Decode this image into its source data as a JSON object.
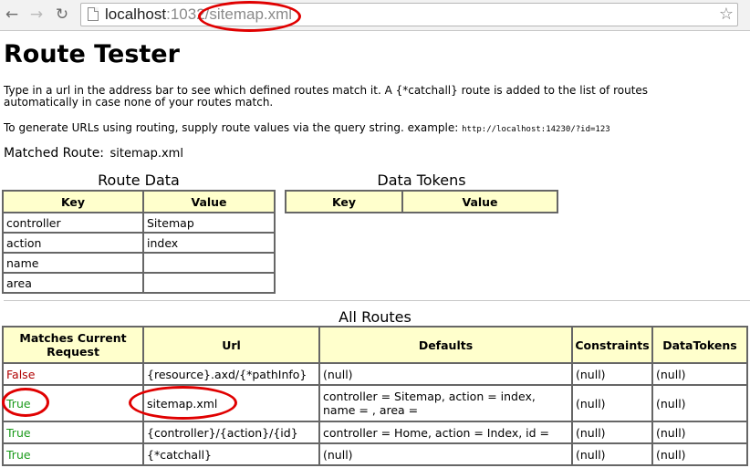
{
  "browser": {
    "back_label": "←",
    "forward_label": "→",
    "reload_label": "↻",
    "url_host": "localhost",
    "url_port": ":1032",
    "url_path": "/sitemap.xml",
    "star_label": "☆"
  },
  "page": {
    "title": "Route Tester",
    "intro": "Type in a url in the address bar to see which defined routes match it. A {*catchall} route is added to the list of routes automatically in case none of your routes match.",
    "howto": "To generate URLs using routing, supply route values via the query string. example:",
    "howto_example": "http://localhost:14230/?id=123",
    "matched_label": "Matched Route:",
    "matched_value": "sitemap.xml"
  },
  "route_data": {
    "caption": "Route Data",
    "headers": [
      "Key",
      "Value"
    ],
    "rows": [
      {
        "key": "controller",
        "value": "Sitemap"
      },
      {
        "key": "action",
        "value": "index"
      },
      {
        "key": "name",
        "value": ""
      },
      {
        "key": "area",
        "value": ""
      }
    ]
  },
  "data_tokens": {
    "caption": "Data Tokens",
    "headers": [
      "Key",
      "Value"
    ]
  },
  "all_routes": {
    "caption": "All Routes",
    "headers": {
      "matches": "Matches Current Request",
      "url": "Url",
      "defaults": "Defaults",
      "constraints": "Constraints",
      "datatokens": "DataTokens"
    },
    "rows": [
      {
        "matches": "False",
        "url": "{resource}.axd/{*pathInfo}",
        "defaults": "(null)",
        "constraints": "(null)",
        "datatokens": "(null)"
      },
      {
        "matches": "True",
        "url": "sitemap.xml",
        "defaults": "controller = Sitemap, action = index, name = , area =",
        "constraints": "(null)",
        "datatokens": "(null)"
      },
      {
        "matches": "True",
        "url": "{controller}/{action}/{id}",
        "defaults": "controller = Home, action = Index, id =",
        "constraints": "(null)",
        "datatokens": "(null)"
      },
      {
        "matches": "True",
        "url": "{*catchall}",
        "defaults": "(null)",
        "constraints": "(null)",
        "datatokens": "(null)"
      }
    ]
  },
  "colors": {
    "header_bg": "#ffffcc",
    "false_color": "#b00000",
    "true_color": "#1a9a1a",
    "highlight": "#e00000"
  }
}
